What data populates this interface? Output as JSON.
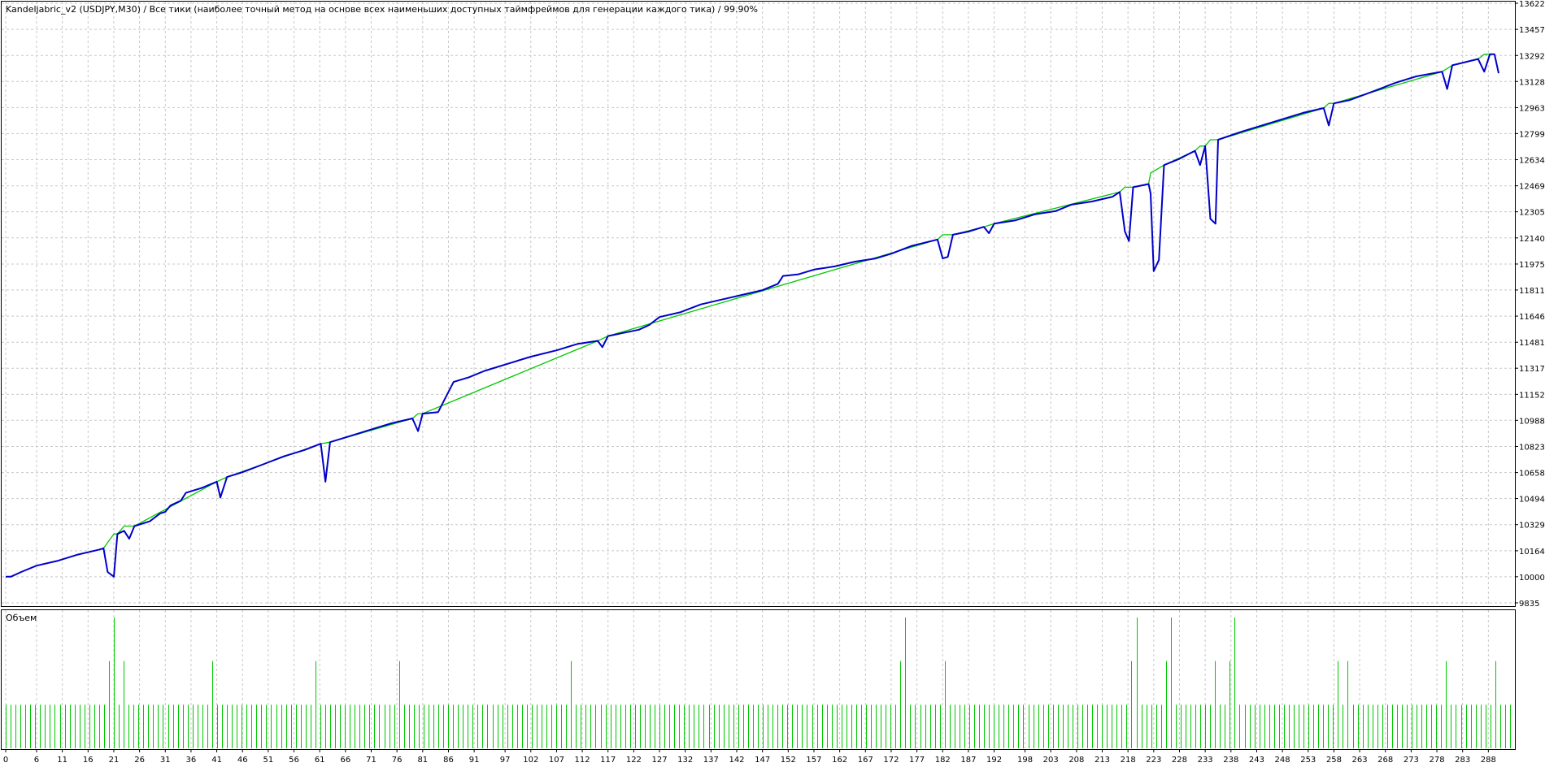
{
  "header": "Kandeljabric_v2 (USDJPY,M30) / Все тики (наиболее точный метод на основе всех наименьших доступных таймфреймов для генерации каждого тика) / 99.90%",
  "volume_label": "Объем",
  "colors": {
    "balance": "#0000c8",
    "equity": "#00c800",
    "volume": "#00c800",
    "grid": "#c8c8c8",
    "frame": "#000000"
  },
  "chart_data": [
    {
      "type": "line",
      "title": "Kandeljabric_v2 (USDJPY,M30) / Все тики (наиболее точный метод на основе всех наименьших доступных таймфреймов для генерации каждого тика) / 99.90%",
      "ylim": [
        9835,
        13622
      ],
      "yticks": [
        13622,
        13457,
        13292,
        13128,
        12963,
        12799,
        12634,
        12469,
        12305,
        12140,
        11975,
        11811,
        11646,
        11481,
        11317,
        11152,
        10988,
        10823,
        10658,
        10494,
        10329,
        10164,
        10000,
        9835
      ],
      "xlim": [
        0,
        293
      ],
      "xticks": [
        0,
        6,
        11,
        16,
        21,
        26,
        31,
        36,
        41,
        46,
        51,
        56,
        61,
        66,
        71,
        76,
        81,
        86,
        91,
        97,
        102,
        107,
        112,
        117,
        122,
        127,
        132,
        137,
        142,
        147,
        152,
        157,
        162,
        167,
        172,
        177,
        182,
        187,
        192,
        198,
        203,
        208,
        213,
        218,
        223,
        228,
        233,
        238,
        243,
        248,
        253,
        258,
        263,
        268,
        273,
        278,
        283,
        288
      ],
      "series": [
        {
          "name": "",
          "color": "#0000c8",
          "points": [
            [
              0,
              10000
            ],
            [
              1,
              10000
            ],
            [
              3,
              10030
            ],
            [
              6,
              10070
            ],
            [
              10,
              10100
            ],
            [
              14,
              10140
            ],
            [
              18,
              10170
            ],
            [
              19,
              10180
            ],
            [
              19.8,
              10030
            ],
            [
              21,
              10000
            ],
            [
              21.7,
              10270
            ],
            [
              23,
              10290
            ],
            [
              24,
              10240
            ],
            [
              25,
              10320
            ],
            [
              28,
              10350
            ],
            [
              30,
              10400
            ],
            [
              31,
              10410
            ],
            [
              32,
              10450
            ],
            [
              34,
              10480
            ],
            [
              35,
              10530
            ],
            [
              38,
              10560
            ],
            [
              41,
              10600
            ],
            [
              41.7,
              10500
            ],
            [
              43,
              10630
            ],
            [
              46,
              10660
            ],
            [
              50,
              10710
            ],
            [
              54,
              10760
            ],
            [
              58,
              10800
            ],
            [
              61.2,
              10840
            ],
            [
              62.1,
              10600
            ],
            [
              63,
              10850
            ],
            [
              67,
              10890
            ],
            [
              71,
              10930
            ],
            [
              75,
              10970
            ],
            [
              79,
              11000
            ],
            [
              80.1,
              10920
            ],
            [
              81,
              11030
            ],
            [
              84,
              11040
            ],
            [
              87,
              11230
            ],
            [
              90,
              11260
            ],
            [
              93,
              11300
            ],
            [
              98,
              11350
            ],
            [
              102,
              11390
            ],
            [
              107,
              11430
            ],
            [
              111,
              11470
            ],
            [
              115,
              11490
            ],
            [
              115.9,
              11450
            ],
            [
              117,
              11520
            ],
            [
              120,
              11540
            ],
            [
              123,
              11560
            ],
            [
              125,
              11590
            ],
            [
              127,
              11640
            ],
            [
              131,
              11670
            ],
            [
              135,
              11720
            ],
            [
              139,
              11750
            ],
            [
              143,
              11780
            ],
            [
              147,
              11810
            ],
            [
              150,
              11850
            ],
            [
              151,
              11900
            ],
            [
              154,
              11910
            ],
            [
              157,
              11940
            ],
            [
              161,
              11960
            ],
            [
              165,
              11990
            ],
            [
              169,
              12010
            ],
            [
              172,
              12040
            ],
            [
              176,
              12090
            ],
            [
              181,
              12130
            ],
            [
              182,
              12010
            ],
            [
              183,
              12020
            ],
            [
              184,
              12160
            ],
            [
              187,
              12180
            ],
            [
              190,
              12210
            ],
            [
              191,
              12170
            ],
            [
              192,
              12230
            ],
            [
              196,
              12250
            ],
            [
              200,
              12290
            ],
            [
              204,
              12310
            ],
            [
              207,
              12350
            ],
            [
              211,
              12370
            ],
            [
              215,
              12400
            ],
            [
              216.4,
              12430
            ],
            [
              217.4,
              12180
            ],
            [
              218.2,
              12120
            ],
            [
              219,
              12460
            ],
            [
              222,
              12480
            ],
            [
              222.4,
              12420
            ],
            [
              223,
              11930
            ],
            [
              224,
              12000
            ],
            [
              225,
              12600
            ],
            [
              228,
              12640
            ],
            [
              231,
              12690
            ],
            [
              232,
              12600
            ],
            [
              233,
              12720
            ],
            [
              234,
              12260
            ],
            [
              235,
              12230
            ],
            [
              235.5,
              12760
            ],
            [
              240,
              12810
            ],
            [
              244,
              12850
            ],
            [
              248,
              12890
            ],
            [
              252,
              12930
            ],
            [
              256,
              12960
            ],
            [
              257,
              12850
            ],
            [
              258,
              12990
            ],
            [
              261,
              13010
            ],
            [
              266,
              13070
            ],
            [
              270,
              13120
            ],
            [
              274,
              13160
            ],
            [
              279,
              13190
            ],
            [
              280,
              13080
            ],
            [
              281,
              13230
            ],
            [
              286,
              13270
            ],
            [
              287.2,
              13190
            ],
            [
              288.3,
              13300
            ],
            [
              289.2,
              13300
            ],
            [
              290,
              13180
            ]
          ]
        },
        {
          "name": "",
          "color": "#00c800",
          "points": [
            [
              18,
              10170
            ],
            [
              19,
              10180
            ],
            [
              21,
              10270
            ],
            [
              21.7,
              10270
            ],
            [
              23,
              10320
            ],
            [
              25,
              10320
            ],
            [
              41,
              10600
            ],
            [
              43,
              10630
            ],
            [
              61.2,
              10840
            ],
            [
              63,
              10850
            ],
            [
              79,
              11000
            ],
            [
              80.1,
              11030
            ],
            [
              81,
              11030
            ],
            [
              115,
              11490
            ],
            [
              117,
              11520
            ],
            [
              181,
              12130
            ],
            [
              182,
              12160
            ],
            [
              184,
              12160
            ],
            [
              190,
              12210
            ],
            [
              192,
              12230
            ],
            [
              216.4,
              12430
            ],
            [
              217.4,
              12460
            ],
            [
              219,
              12460
            ],
            [
              222,
              12480
            ],
            [
              222.4,
              12550
            ],
            [
              225,
              12600
            ],
            [
              231,
              12690
            ],
            [
              232,
              12720
            ],
            [
              233,
              12720
            ],
            [
              234,
              12760
            ],
            [
              235.5,
              12760
            ],
            [
              256,
              12960
            ],
            [
              257,
              12990
            ],
            [
              258,
              12990
            ],
            [
              279,
              13190
            ],
            [
              281,
              13230
            ],
            [
              286,
              13270
            ],
            [
              287.2,
              13300
            ],
            [
              288.3,
              13300
            ]
          ]
        }
      ]
    },
    {
      "type": "bar",
      "title": "Объем",
      "xlim": [
        0,
        293
      ],
      "ylim": [
        0,
        3
      ],
      "values": [
        1,
        1,
        1,
        1,
        1,
        1,
        1,
        1,
        1,
        1,
        1,
        1,
        1,
        1,
        1,
        1,
        1,
        1,
        1,
        1,
        1,
        2,
        3,
        1,
        2,
        1,
        1,
        1,
        1,
        1,
        1,
        1,
        1,
        1,
        1,
        1,
        1,
        1,
        1,
        1,
        1,
        1,
        2,
        1,
        1,
        1,
        1,
        1,
        1,
        1,
        1,
        1,
        1,
        1,
        1,
        1,
        1,
        1,
        1,
        1,
        1,
        1,
        1,
        2,
        1,
        1,
        1,
        1,
        1,
        1,
        1,
        1,
        1,
        1,
        1,
        1,
        1,
        1,
        1,
        1,
        2,
        1,
        1,
        1,
        1,
        1,
        1,
        1,
        1,
        1,
        1,
        1,
        1,
        1,
        1,
        1,
        1,
        1,
        1,
        1,
        1,
        1,
        1,
        1,
        1,
        1,
        1,
        1,
        1,
        1,
        1,
        1,
        1,
        1,
        1,
        2,
        1,
        1,
        1,
        1,
        1,
        1,
        1,
        1,
        1,
        1,
        1,
        1,
        1,
        1,
        1,
        1,
        1,
        1,
        1,
        1,
        1,
        1,
        1,
        1,
        1,
        1,
        1,
        1,
        1,
        1,
        1,
        1,
        1,
        1,
        1,
        1,
        1,
        1,
        1,
        1,
        1,
        1,
        1,
        1,
        1,
        1,
        1,
        1,
        1,
        1,
        1,
        1,
        1,
        1,
        1,
        1,
        1,
        1,
        1,
        1,
        1,
        1,
        1,
        1,
        1,
        1,
        2,
        3,
        1,
        1,
        1,
        1,
        1,
        1,
        1,
        2,
        1,
        1,
        1,
        1,
        1,
        1,
        1,
        1,
        1,
        1,
        1,
        1,
        1,
        1,
        1,
        1,
        1,
        1,
        1,
        1,
        1,
        1,
        1,
        1,
        1,
        1,
        1,
        1,
        1,
        1,
        1,
        1,
        1,
        1,
        1,
        1,
        1,
        2,
        3,
        1,
        1,
        1,
        1,
        1,
        2,
        3,
        1,
        1,
        1,
        1,
        1,
        1,
        1,
        1,
        2,
        1,
        1,
        2,
        3,
        1,
        1,
        1,
        1,
        1,
        1,
        1,
        1,
        1,
        1,
        1,
        1,
        1,
        1,
        1,
        1,
        1,
        1,
        1,
        1,
        2,
        1,
        2,
        1,
        1,
        1,
        1,
        1,
        1,
        1,
        1,
        1,
        1,
        1,
        1,
        1,
        1,
        1,
        1,
        1,
        1,
        1,
        2,
        1,
        1,
        1,
        1,
        1,
        1,
        1,
        1,
        1,
        2,
        1,
        1,
        1
      ]
    }
  ]
}
